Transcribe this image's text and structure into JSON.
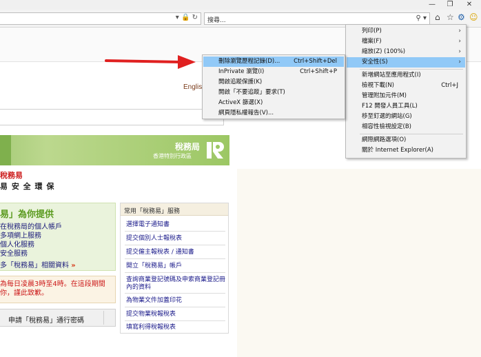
{
  "browser": {
    "search_placeholder": "搜尋...",
    "window_controls": {
      "minimize": "—",
      "restore": "❐",
      "close": "✕"
    },
    "toolbar_icons": [
      "home-icon",
      "favorites-star-icon",
      "tools-gear-icon",
      "smiley-icon"
    ]
  },
  "page": {
    "english_link": "Englis",
    "banner": {
      "title": "稅務局",
      "subtitle": "香港特別行政區"
    },
    "brand": "稅務易",
    "tagline": "易 安 全 環 保",
    "promo": {
      "title": "易」為你提供",
      "lines": [
        "在稅務局的個人帳戶",
        "多項網上服務",
        "個人化服務",
        "安全服務"
      ],
      "more": "多「稅務易」相關資料",
      "more_arrow": "»"
    },
    "notice": "為每日凌晨3時至4時。在這段期間你，謹此致歉。",
    "password_button": "申請「稅務易」通行密碼",
    "services": {
      "title": "常用「稅務易」服務",
      "items": [
        "選擇電子通知書",
        "提交個別人士報稅表",
        "提交僱主報稅表 / 通知書",
        "開立「稅務易」帳戶",
        "查詢商業登記號碼及申索商業登記冊內的資料",
        "為物業文件加蓋印花",
        "提交物業稅報稅表",
        "填寫利得稅報稅表"
      ]
    }
  },
  "tools_menu": {
    "items": [
      {
        "label": "列印(P)",
        "submenu": true
      },
      {
        "label": "檔案(F)",
        "submenu": true
      },
      {
        "label": "縮放(Z) (100%)",
        "submenu": true
      },
      {
        "label": "安全性(S)",
        "submenu": true,
        "highlighted": true
      },
      {
        "label": "新增網站至應用程式(I)"
      },
      {
        "label": "檢視下載(N)",
        "shortcut": "Ctrl+J"
      },
      {
        "label": "管理附加元件(M)"
      },
      {
        "label": "F12 開發人員工具(L)"
      },
      {
        "label": "移至釘選的網站(G)"
      },
      {
        "label": "相容性檢視設定(B)"
      },
      {
        "label": "網際網路選項(O)"
      },
      {
        "label": "關於 Internet Explorer(A)"
      }
    ]
  },
  "safety_menu": {
    "items": [
      {
        "label": "刪除瀏覽歷程記錄(D)...",
        "shortcut": "Ctrl+Shift+Del",
        "highlighted": true
      },
      {
        "label": "InPrivate 瀏覽(I)",
        "shortcut": "Ctrl+Shift+P"
      },
      {
        "label": "開啟追蹤保護(K)"
      },
      {
        "label": "開啟「不要追蹤」要求(T)"
      },
      {
        "label": "ActiveX 篩選(X)"
      },
      {
        "label": "網頁隱私權報告(V)..."
      }
    ]
  },
  "colors": {
    "menu_highlight": "#91c9f7",
    "arrow": "#e02020",
    "brand_red": "#cc1a1a",
    "banner_green": "#9cc764"
  }
}
